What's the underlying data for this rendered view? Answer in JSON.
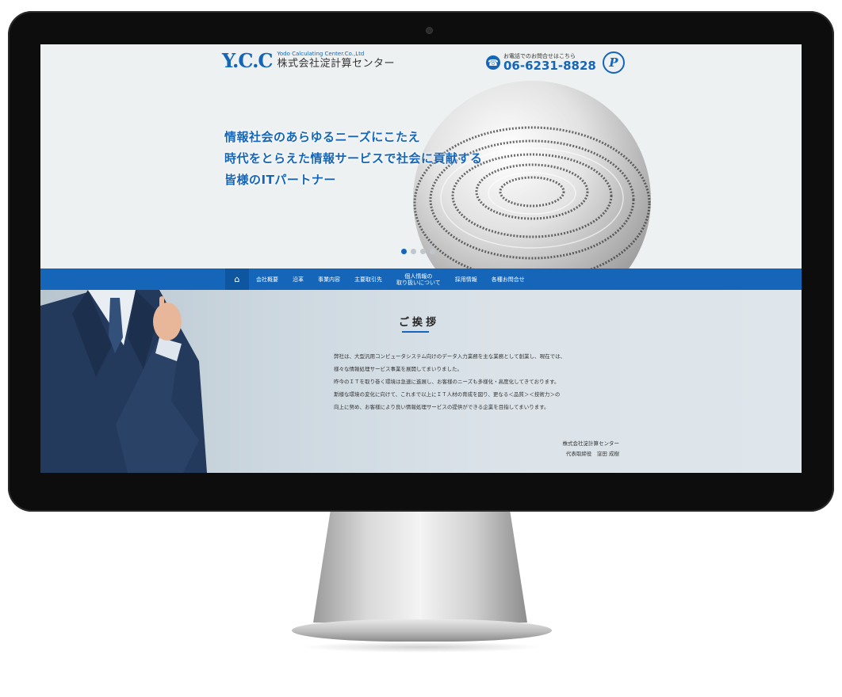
{
  "header": {
    "logo_mark": "Y.C.C",
    "logo_en": "Yodo Calculating Center.Co.,Ltd",
    "logo_jp": "株式会社淀計算センター",
    "contact_label": "お電話でのお問合せはこちら",
    "phone": "06-6231-8828",
    "privacy_mark": "P"
  },
  "hero": {
    "lines": [
      "情報社会のあらゆるニーズにこたえ",
      "時代をとらえた情報サービスで社会に貢献する",
      "皆様のITパートナー"
    ],
    "slides_total": 4,
    "slide_active": 1
  },
  "nav": {
    "items": [
      "会社概要",
      "沿革",
      "事業内容",
      "主要取引先",
      "個人情報の\n取り扱いについて",
      "採用情報",
      "各種お問合せ"
    ]
  },
  "greeting": {
    "title": "ご挨拶",
    "paragraphs": [
      "弊社は、大型汎用コンピュータシステム向けのデータ入力業務を主な業務として創業し、現在では、",
      "様々な情報処理サービス事業を展開してまいりました。",
      "昨今のＩＴを取り巻く環境は急速に進展し、お客様のニーズも多様化・高度化してきております。",
      "斯様な環境の変化に向けて、これまで以上にＩＴ人材の育成を図り、更なる＜品質＞＜技術力＞の",
      "向上に努め、お客様により良い情報処理サービスの提供ができる企業を目指してまいります。"
    ],
    "company": "株式会社淀計算センター",
    "signature": "代表取締役　窪田 成樹"
  },
  "colors": {
    "brand_blue": "#1565b8",
    "bezel": "#0d0d0d"
  },
  "icons": [
    "camera-icon",
    "phone-icon",
    "privacy-mark-icon",
    "home-icon"
  ]
}
